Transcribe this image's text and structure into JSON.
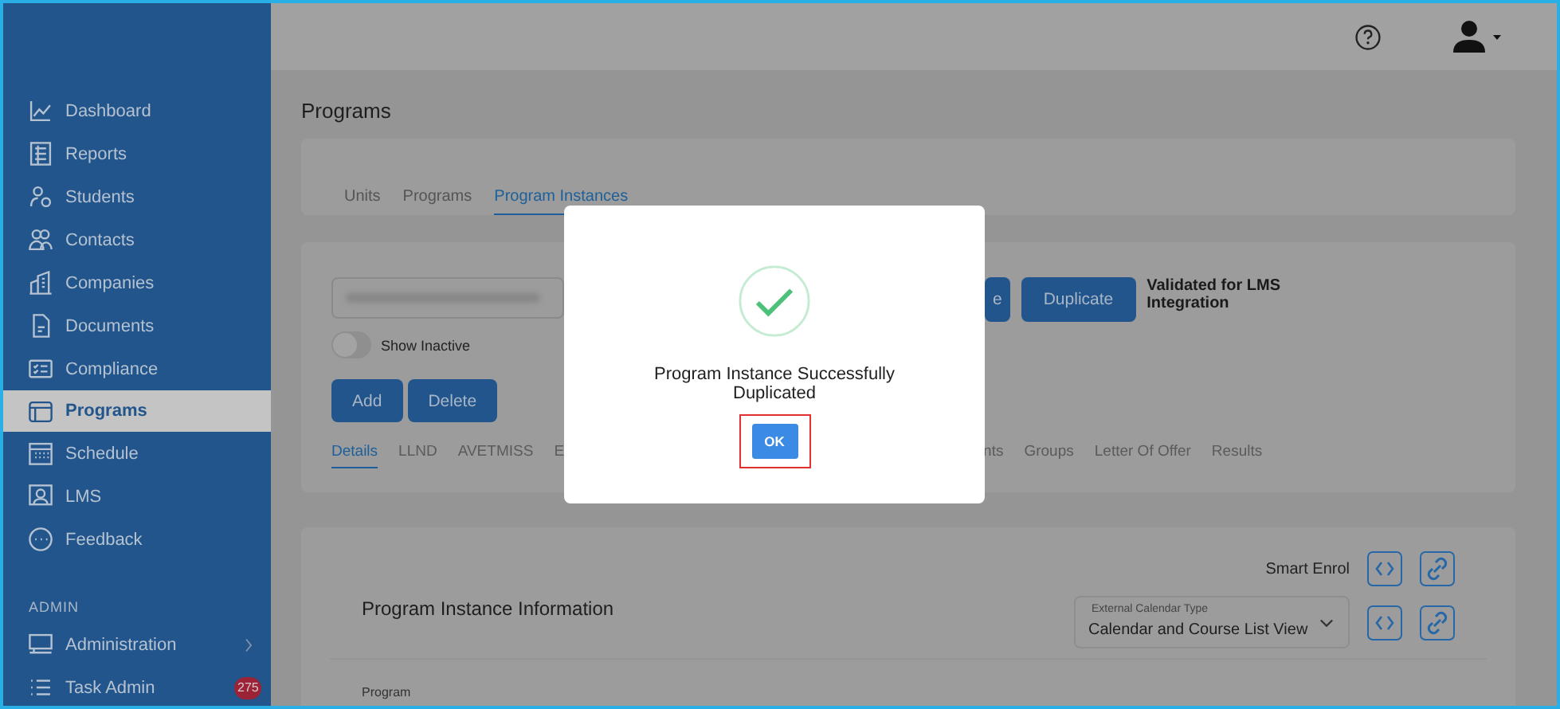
{
  "sidebar": {
    "items": [
      {
        "label": "Dashboard",
        "selected": false
      },
      {
        "label": "Reports",
        "selected": false
      },
      {
        "label": "Students",
        "selected": false
      },
      {
        "label": "Contacts",
        "selected": false
      },
      {
        "label": "Companies",
        "selected": false
      },
      {
        "label": "Documents",
        "selected": false
      },
      {
        "label": "Compliance",
        "selected": false
      },
      {
        "label": "Programs",
        "selected": true
      },
      {
        "label": "Schedule",
        "selected": false
      },
      {
        "label": "LMS",
        "selected": false
      },
      {
        "label": "Feedback",
        "selected": false
      }
    ],
    "section": "ADMIN",
    "admin_items": [
      {
        "label": "Administration",
        "selected": false,
        "submenu": true
      },
      {
        "label": "Task Admin",
        "selected": false,
        "badge": "275"
      }
    ]
  },
  "page_title": "Programs",
  "top_tabs": [
    {
      "label": "Units",
      "selected": false
    },
    {
      "label": "Programs",
      "selected": false
    },
    {
      "label": "Program Instances",
      "selected": true
    }
  ],
  "instance": {
    "buttons": [
      "e",
      "Duplicate"
    ],
    "note": "Validated for LMS Integration",
    "show_inactive": {
      "label": "Show Inactive",
      "on": false
    },
    "actions": [
      "Add",
      "Delete"
    ],
    "tabs": [
      {
        "label": "Details",
        "selected": true
      },
      {
        "label": "LLND",
        "selected": false
      },
      {
        "label": "AVETMISS",
        "selected": false
      },
      {
        "label": "E",
        "selected": false
      },
      {
        "label": "nts",
        "selected": false
      },
      {
        "label": "Groups",
        "selected": false
      },
      {
        "label": "Letter Of Offer",
        "selected": false
      },
      {
        "label": "Results",
        "selected": false
      }
    ]
  },
  "info": {
    "title": "Program Instance Information",
    "smart_enrol": "Smart Enrol",
    "calendar_select": {
      "label": "External Calendar Type",
      "value": "Calendar and Course List View"
    },
    "field_label": "Program"
  },
  "dialog": {
    "message": "Program Instance Successfully Duplicated",
    "button": "OK",
    "focused": true
  }
}
